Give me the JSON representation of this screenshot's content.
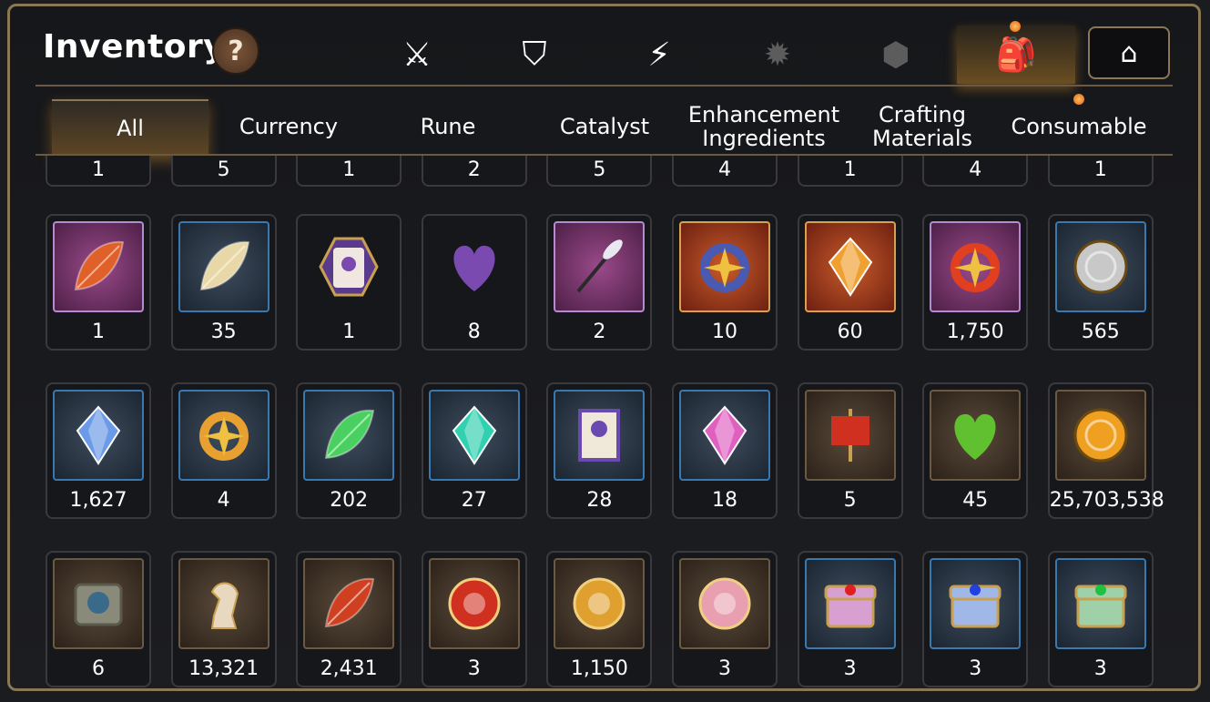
{
  "header": {
    "title": "Inventory",
    "help_label": "?"
  },
  "icon_tabs": [
    {
      "name": "knight-shield-icon",
      "glyph": "⚔",
      "state": "normal"
    },
    {
      "name": "broken-shield-icon",
      "glyph": "⛉",
      "state": "normal"
    },
    {
      "name": "lightning-icon",
      "glyph": "⚡",
      "state": "normal"
    },
    {
      "name": "splat-icon",
      "glyph": "✹",
      "state": "dim"
    },
    {
      "name": "dice-icon",
      "glyph": "⬢",
      "state": "dim"
    },
    {
      "name": "backpack-icon",
      "glyph": "🎒",
      "state": "active"
    },
    {
      "name": "castle-icon",
      "glyph": "⌂",
      "state": "boxed"
    }
  ],
  "category_tabs": [
    {
      "label": "All",
      "active": true
    },
    {
      "label": "Currency",
      "active": false
    },
    {
      "label": "Rune",
      "active": false
    },
    {
      "label": "Catalyst",
      "active": false
    },
    {
      "label": "Enhancement Ingredients",
      "active": false
    },
    {
      "label": "Crafting Materials",
      "active": false
    },
    {
      "label": "Consumable",
      "active": false
    }
  ],
  "top_row_quantities": [
    "1",
    "5",
    "1",
    "2",
    "5",
    "4",
    "1",
    "4",
    "1"
  ],
  "items": [
    [
      {
        "icon": "red-feather-icon",
        "frame": "purple",
        "qty": "1",
        "color": "#e0602a"
      },
      {
        "icon": "white-feathers-icon",
        "frame": "blue",
        "qty": "35",
        "color": "#e8d8a8"
      },
      {
        "icon": "pet-bag-badge-icon",
        "frame": "none",
        "qty": "1",
        "color": "#7a4ab0"
      },
      {
        "icon": "pet-bag-heart-icon",
        "frame": "none",
        "qty": "8",
        "color": "#7a4ab0"
      },
      {
        "icon": "cat-teaser-wand-icon",
        "frame": "purple",
        "qty": "2",
        "color": "#e8e8f0"
      },
      {
        "icon": "blue-leash-icon",
        "frame": "orange",
        "qty": "10",
        "color": "#4a5ab0"
      },
      {
        "icon": "fire-crystal-icon",
        "frame": "orange",
        "qty": "60",
        "color": "#f0a030"
      },
      {
        "icon": "red-collar-icon",
        "frame": "purple",
        "qty": "1,750",
        "color": "#e04020"
      },
      {
        "icon": "silver-coin-icon",
        "frame": "blue",
        "qty": "565",
        "color": "#c8c8c8"
      }
    ],
    [
      {
        "icon": "blue-gem-icon",
        "frame": "blue",
        "qty": "1,627",
        "color": "#6a9ae8"
      },
      {
        "icon": "star-amulet-icon",
        "frame": "blue",
        "qty": "4",
        "color": "#e8a030"
      },
      {
        "icon": "green-leaf-icon",
        "frame": "blue",
        "qty": "202",
        "color": "#4ad060"
      },
      {
        "icon": "teal-crystal-icon",
        "frame": "blue",
        "qty": "27",
        "color": "#30d0b0"
      },
      {
        "icon": "pet-certificate-icon",
        "frame": "blue",
        "qty": "28",
        "color": "#6a4ab0"
      },
      {
        "icon": "pink-crystal-pile-icon",
        "frame": "blue",
        "qty": "18",
        "color": "#e060c0"
      },
      {
        "icon": "war-banner-icon",
        "frame": "brown",
        "qty": "5",
        "color": "#d03020"
      },
      {
        "icon": "green-heart-icon",
        "frame": "brown",
        "qty": "45",
        "color": "#60c030"
      },
      {
        "icon": "sun-coin-icon",
        "frame": "brown",
        "qty": "25,703,538",
        "color": "#f0a020"
      }
    ],
    [
      {
        "icon": "stone-compass-icon",
        "frame": "brown",
        "qty": "6",
        "color": "#8a8a7a"
      },
      {
        "icon": "knight-chess-icon",
        "frame": "brown",
        "qty": "13,321",
        "color": "#e8d8c0"
      },
      {
        "icon": "red-leaves-icon",
        "frame": "brown",
        "qty": "2,431",
        "color": "#d04020"
      },
      {
        "icon": "red-seal-icon",
        "frame": "brown",
        "qty": "3",
        "color": "#d03020"
      },
      {
        "icon": "fist-badge-icon",
        "frame": "brown",
        "qty": "1,150",
        "color": "#e0a030"
      },
      {
        "icon": "pet-orb-icon",
        "frame": "brown",
        "qty": "3",
        "color": "#e8a0b0"
      },
      {
        "icon": "pink-chest-icon",
        "frame": "blue",
        "qty": "3",
        "color": "#d8a0d0"
      },
      {
        "icon": "blue-chest-icon",
        "frame": "blue",
        "qty": "3",
        "color": "#a0b8e8"
      },
      {
        "icon": "green-chest-icon",
        "frame": "blue",
        "qty": "3",
        "color": "#a0d0a8"
      }
    ]
  ]
}
